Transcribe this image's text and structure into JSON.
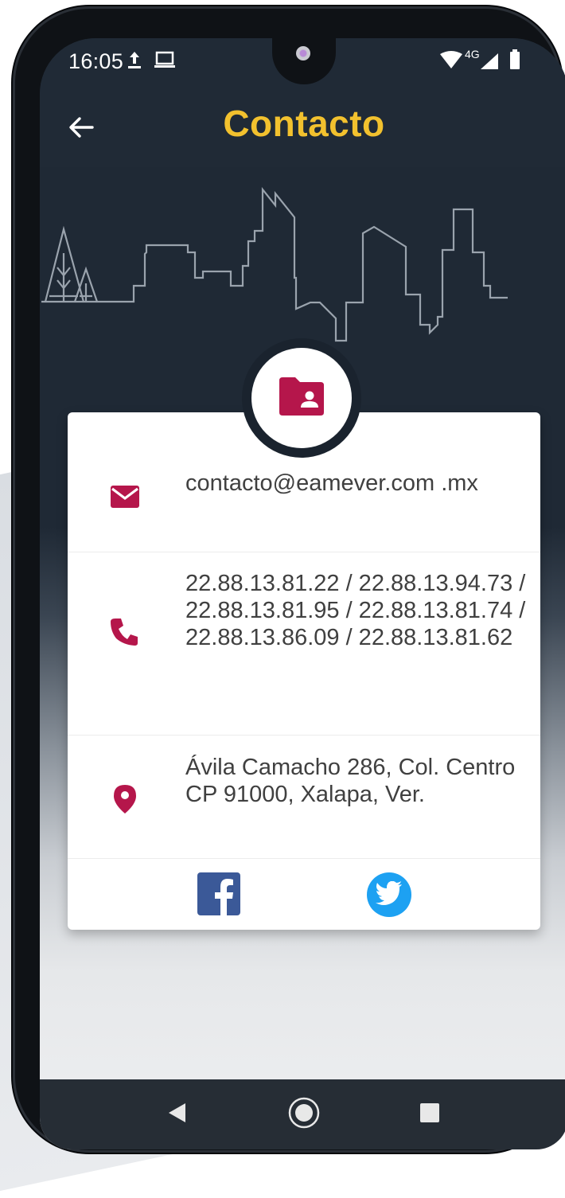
{
  "status_bar": {
    "time": "16:05",
    "network": "4G"
  },
  "header": {
    "title": "Contacto"
  },
  "contact": {
    "email": "contacto@eamever.com .mx",
    "phones": "22.88.13.81.22 / 22.88.13.94.73 / 22.88.13.81.95 / 22.88.13.81.74 / 22.88.13.86.09 / 22.88.13.81.62",
    "address": "Ávila Camacho 286, Col. Centro CP 91000, Xalapa, Ver."
  },
  "icons": {
    "back": "arrow-left-icon",
    "badge": "contact-folder-icon",
    "email": "envelope-icon",
    "phone": "phone-icon",
    "address": "map-pin-icon",
    "facebook": "facebook-icon",
    "twitter": "twitter-icon"
  },
  "colors": {
    "accent": "#f2c12e",
    "brand": "#b5164b",
    "header_bg": "#202a36",
    "facebook": "#3b5998",
    "twitter": "#1da1f2"
  }
}
